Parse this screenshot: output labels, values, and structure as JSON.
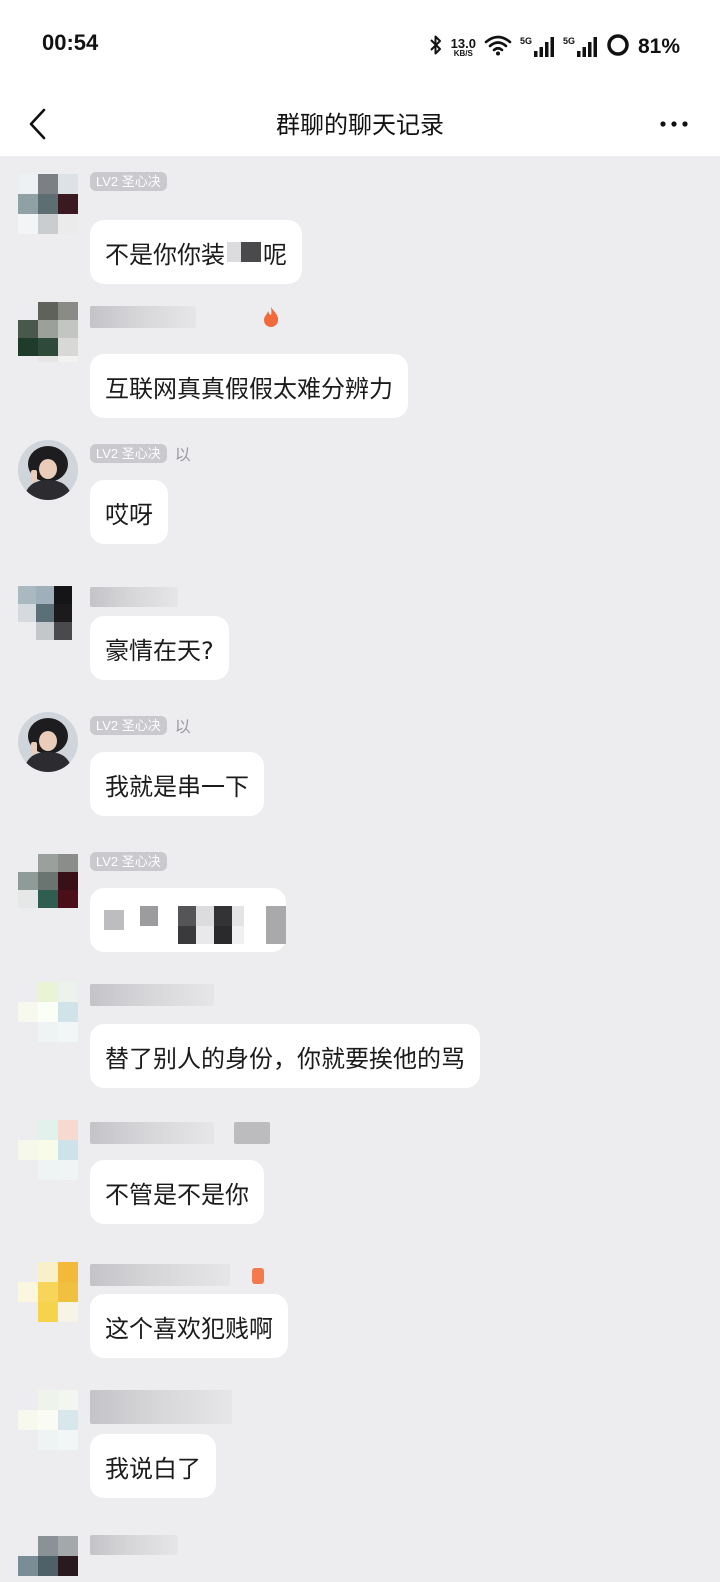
{
  "status_bar": {
    "time": "00:54",
    "net_speed_value": "13.0",
    "net_speed_unit": "KB/S",
    "signal1_label": "5G",
    "signal2_label": "5G",
    "battery_percent": "81%"
  },
  "nav": {
    "title": "群聊的聊天记录"
  },
  "messages": [
    {
      "badge": "LV2 圣心决",
      "suffix": "",
      "text_a": "不是你你装",
      "text_b": "呢"
    },
    {
      "badge": "",
      "suffix": "",
      "text": "互联网真真假假太难分辨力"
    },
    {
      "badge": "LV2 圣心决",
      "suffix": "以",
      "text": "哎呀"
    },
    {
      "badge": "",
      "suffix": "",
      "text": "豪情在天?"
    },
    {
      "badge": "LV2 圣心决",
      "suffix": "以",
      "text": "我就是串一下"
    },
    {
      "badge": "LV2 圣心决",
      "suffix": "",
      "text": ""
    },
    {
      "badge": "",
      "suffix": "",
      "text": "替了别人的身份，你就要挨他的骂"
    },
    {
      "badge": "",
      "suffix": "",
      "text": "不管是不是你"
    },
    {
      "badge": "",
      "suffix": "",
      "text": "这个喜欢犯贱啊"
    },
    {
      "badge": "",
      "suffix": "",
      "text": "我说白了"
    }
  ],
  "colors": {
    "background": "#ededf0",
    "bubble": "#ffffff",
    "badge": "#c9c9ce",
    "fire_badge": "#f26a3c"
  }
}
